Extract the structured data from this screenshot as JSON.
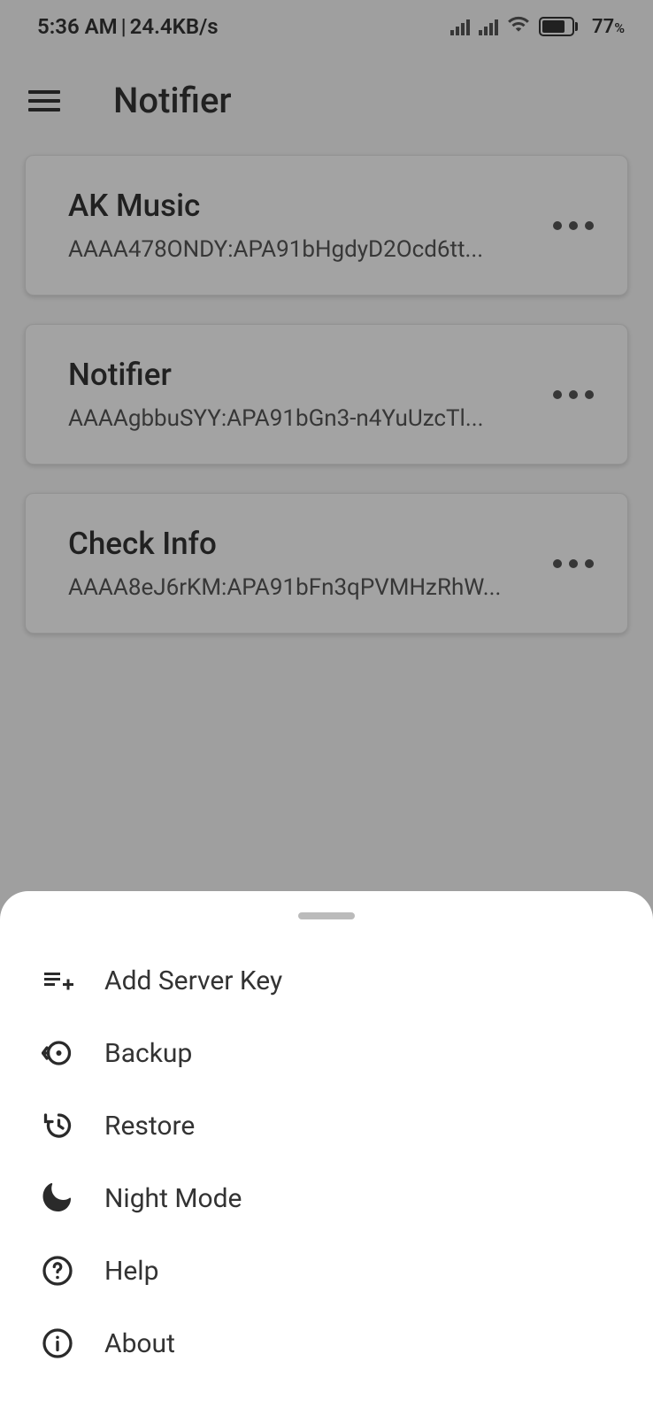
{
  "status": {
    "time": "5:36 AM",
    "separator": " | ",
    "speed": "24.4KB/s",
    "battery": "77",
    "battery_pct": "%"
  },
  "header": {
    "title": "Notifier"
  },
  "cards": [
    {
      "title": "AK Music",
      "key": "AAAA478ONDY:APA91bHgdyD2Ocd6tt..."
    },
    {
      "title": "Notifier",
      "key": "AAAAgbbuSYY:APA91bGn3-n4YuUzcTl..."
    },
    {
      "title": "Check Info",
      "key": "AAAA8eJ6rKM:APA91bFn3qPVMHzRhW..."
    }
  ],
  "sheet": {
    "items": [
      {
        "label": "Add Server Key",
        "icon": "playlist-add"
      },
      {
        "label": "Backup",
        "icon": "backup"
      },
      {
        "label": "Restore",
        "icon": "restore"
      },
      {
        "label": "Night Mode",
        "icon": "moon"
      },
      {
        "label": "Help",
        "icon": "help"
      },
      {
        "label": "About",
        "icon": "info"
      }
    ]
  }
}
